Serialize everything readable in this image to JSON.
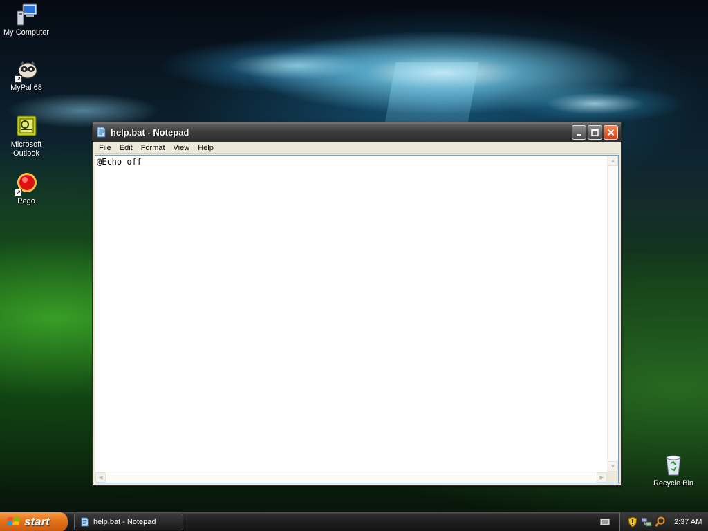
{
  "desktop": {
    "icons": [
      {
        "label": "My Computer",
        "icon": "my-computer-icon"
      },
      {
        "label": "MyPal 68",
        "icon": "mypal-icon"
      },
      {
        "label": "Microsoft Outlook",
        "icon": "outlook-icon"
      },
      {
        "label": "Pego",
        "icon": "pego-icon"
      }
    ],
    "recycle_bin": {
      "label": "Recycle Bin",
      "icon": "recycle-bin-icon"
    }
  },
  "window": {
    "title": "help.bat - Notepad",
    "icon": "notepad-icon",
    "menu": [
      "File",
      "Edit",
      "Format",
      "View",
      "Help"
    ],
    "content": "@Echo off"
  },
  "taskbar": {
    "start_label": "start",
    "tasks": [
      {
        "label": "help.bat - Notepad",
        "icon": "notepad-icon"
      }
    ],
    "tray_icons": [
      "security-shield-icon",
      "network-icon",
      "search-icon"
    ],
    "clock": "2:37 AM"
  },
  "colors": {
    "start_button": "#e8741a",
    "close_button": "#d9532c",
    "titlebar": "#3c3c3c"
  }
}
